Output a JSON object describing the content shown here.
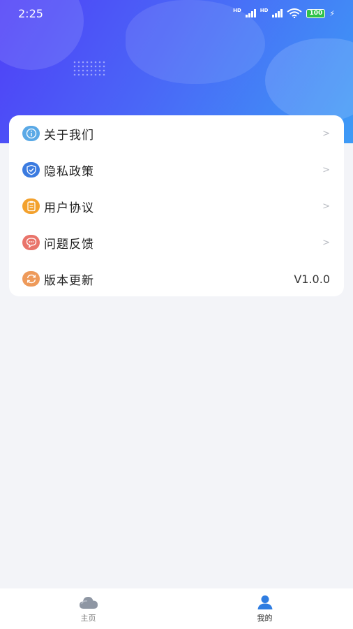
{
  "status_bar": {
    "time": "2:25",
    "battery": "100",
    "network": "HD"
  },
  "menu": [
    {
      "label": "关于我们",
      "icon": "info-icon",
      "color": "#5aa9e6",
      "trailing": ">"
    },
    {
      "label": "隐私政策",
      "icon": "shield-icon",
      "color": "#3b7be0",
      "trailing": ">"
    },
    {
      "label": "用户协议",
      "icon": "document-icon",
      "color": "#f3a12d",
      "trailing": ">"
    },
    {
      "label": "问题反馈",
      "icon": "chat-bubble-icon",
      "color": "#e9746b",
      "trailing": ">"
    },
    {
      "label": "版本更新",
      "icon": "refresh-icon",
      "color": "#ee9a5a",
      "trailing": "V1.0.0"
    }
  ],
  "tabs": [
    {
      "label": "主页",
      "icon": "cloud-icon",
      "active": false
    },
    {
      "label": "我的",
      "icon": "user-icon",
      "active": true
    }
  ],
  "colors": {
    "accent": "#2f7de1",
    "header_start": "#4f3ff7",
    "header_end": "#3d9bf6"
  }
}
